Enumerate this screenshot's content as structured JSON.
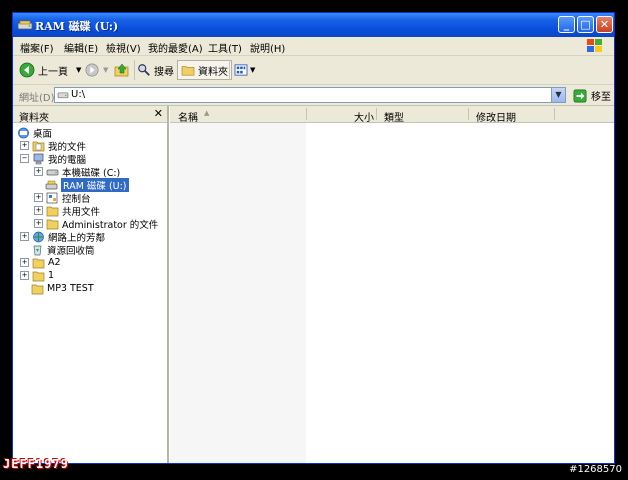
{
  "window": {
    "title": "RAM 磁碟 (U:)",
    "controls": {
      "minimize": "_",
      "maximize": "□",
      "close": "✕"
    }
  },
  "menu": [
    "檔案(F)",
    "編輯(E)",
    "檢視(V)",
    "我的最愛(A)",
    "工具(T)",
    "說明(H)"
  ],
  "toolbar": {
    "back": "上一頁",
    "search": "搜尋",
    "folders": "資料夾"
  },
  "address": {
    "label": "網址(D)",
    "value": "U:\\",
    "go": "移至"
  },
  "folders_pane": {
    "title": "資料夾",
    "close": "✕",
    "tree": [
      {
        "label": "桌面",
        "icon": "desktop-icon",
        "expander": ""
      },
      {
        "label": "我的文件",
        "icon": "my-documents-icon",
        "expander": "+"
      },
      {
        "label": "我的電腦",
        "icon": "my-computer-icon",
        "expander": "−"
      },
      {
        "label": "本機磁碟 (C:)",
        "icon": "local-disk-icon",
        "expander": "+"
      },
      {
        "label": "RAM 磁碟 (U:)",
        "icon": "ram-disk-icon",
        "expander": "",
        "selected": true
      },
      {
        "label": "控制台",
        "icon": "control-panel-icon",
        "expander": "+"
      },
      {
        "label": "共用文件",
        "icon": "folder-icon",
        "expander": "+"
      },
      {
        "label": "Administrator 的文件",
        "icon": "folder-icon",
        "expander": "+"
      },
      {
        "label": "網路上的芳鄰",
        "icon": "network-icon",
        "expander": "+"
      },
      {
        "label": "資源回收筒",
        "icon": "recycle-bin-icon",
        "expander": ""
      },
      {
        "label": "A2",
        "icon": "folder-icon",
        "expander": "+"
      },
      {
        "label": "1",
        "icon": "folder-icon",
        "expander": "+"
      },
      {
        "label": "MP3 TEST",
        "icon": "folder-icon",
        "expander": ""
      }
    ]
  },
  "columns": [
    "名稱",
    "大小",
    "類型",
    "修改日期"
  ],
  "overlay": {
    "watermark": "JEFF1979",
    "id": "#1268570"
  },
  "colors": {
    "titlebar": "#0a4edb",
    "selection": "#316ac5",
    "chrome": "#ece9d8"
  }
}
